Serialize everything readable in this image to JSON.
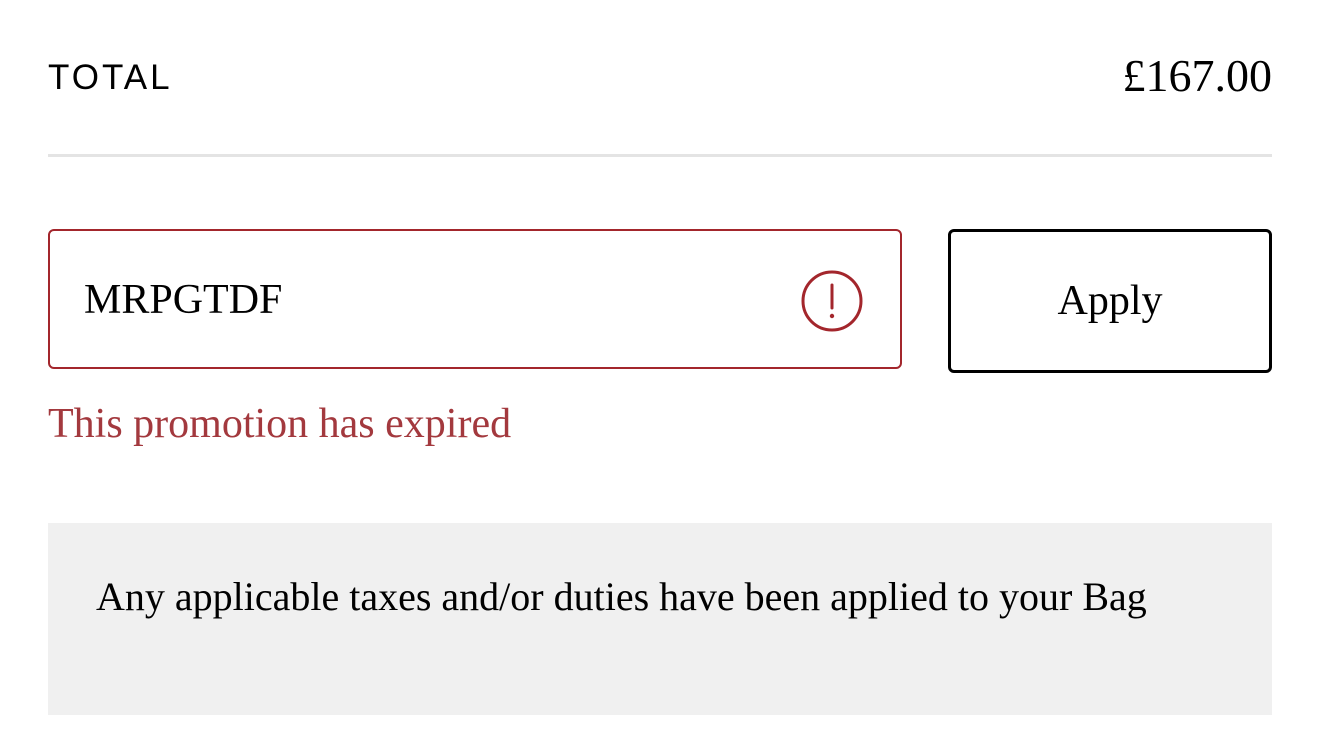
{
  "summary": {
    "total_label": "TOTAL",
    "total_value": "£167.00"
  },
  "promo": {
    "code_value": "MRPGTDF",
    "apply_label": "Apply",
    "error_message": "This promotion has expired",
    "error_icon": "exclamation-circle-icon"
  },
  "notice": {
    "text": "Any applicable taxes and/or duties have been applied to your Bag"
  },
  "colors": {
    "error": "#a3262c",
    "error_text": "#a3393e",
    "notice_bg": "#f0f0f0",
    "divider": "#e4e4e4"
  }
}
